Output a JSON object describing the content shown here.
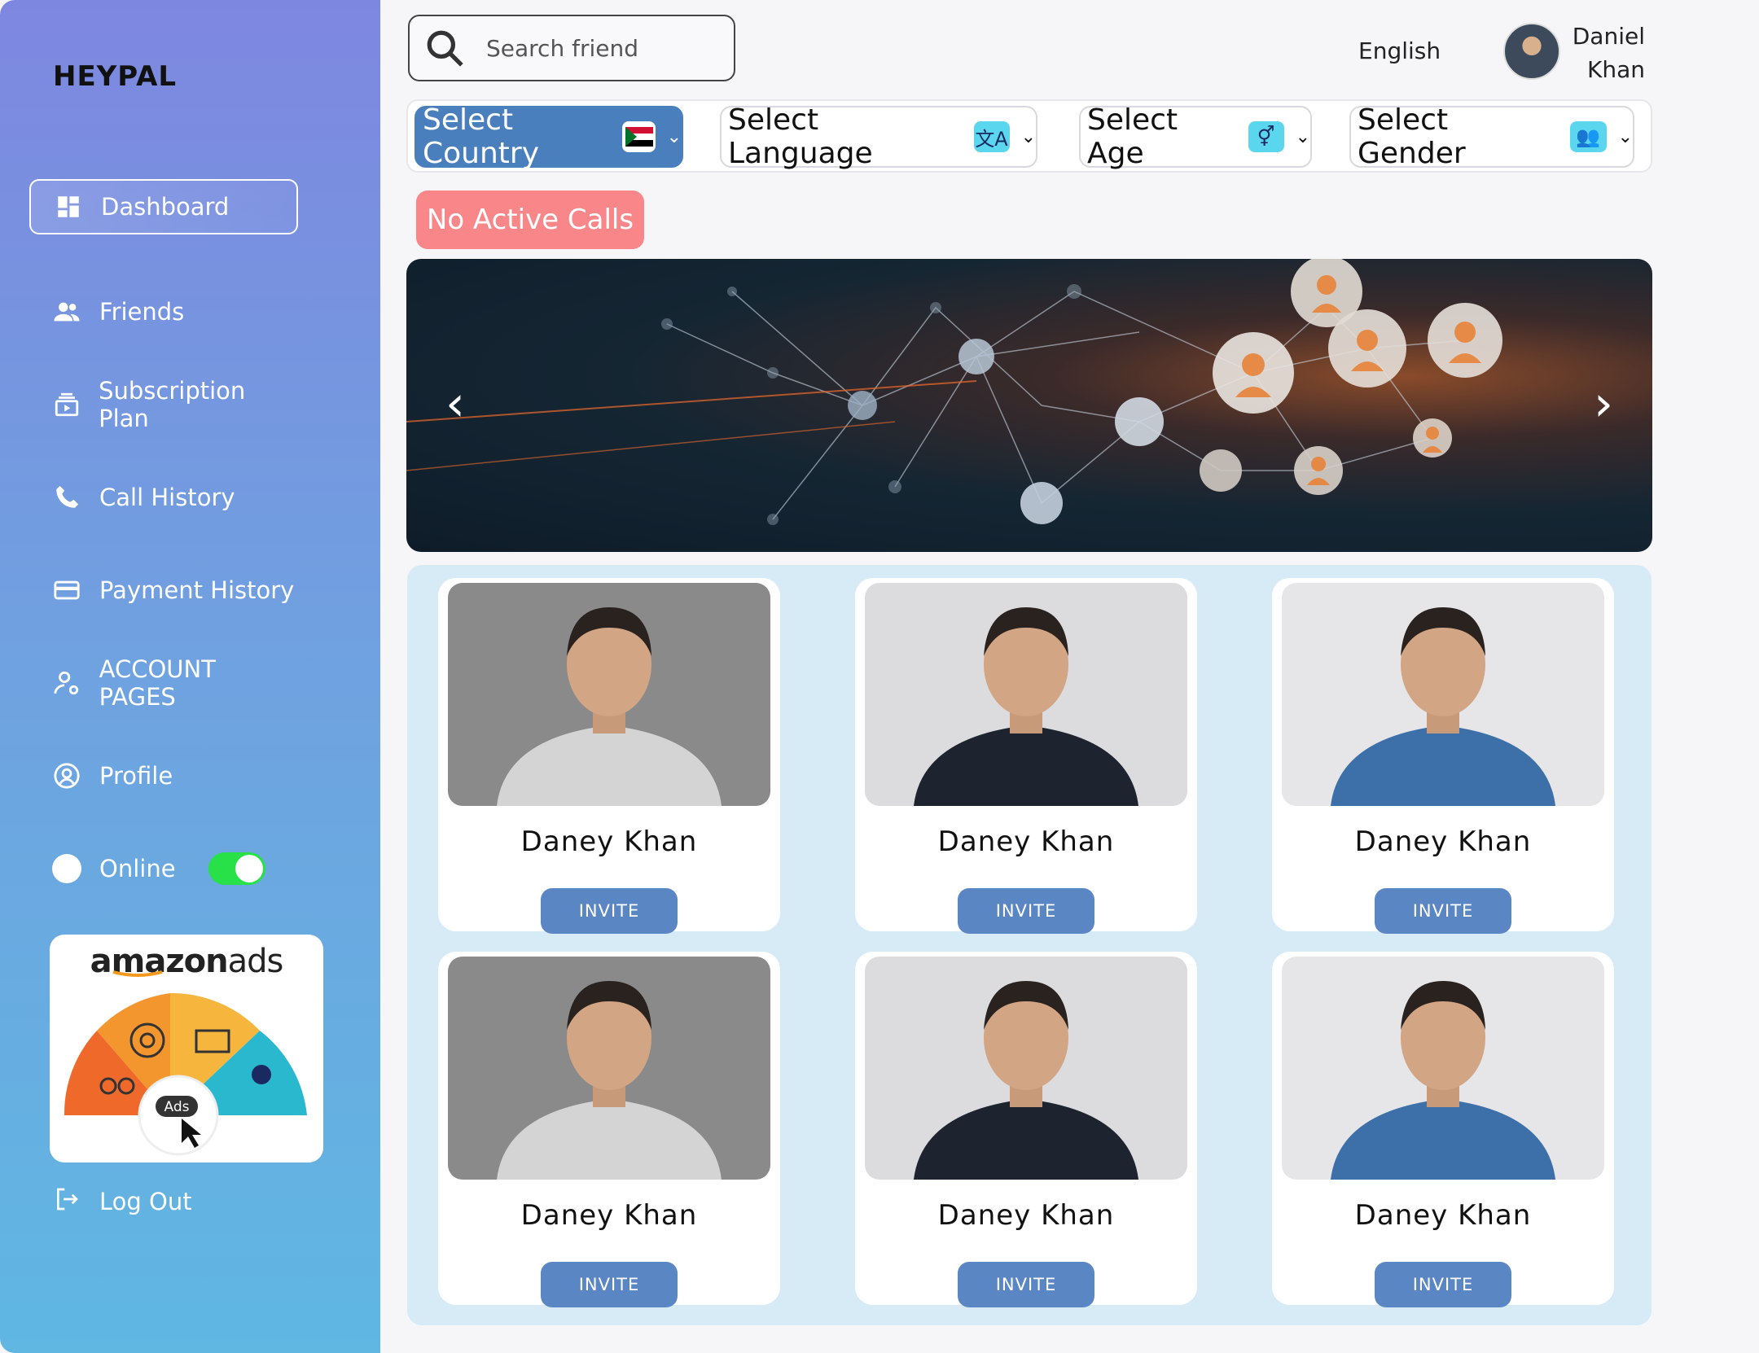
{
  "app": {
    "name": "HEYPAL"
  },
  "sidebar": {
    "items": [
      {
        "label": "Dashboard",
        "icon": "dashboard-icon"
      },
      {
        "label": "Friends",
        "icon": "friends-icon"
      },
      {
        "label": "Subscription Plan",
        "icon": "subscription-icon"
      },
      {
        "label": "Call History",
        "icon": "phone-icon"
      },
      {
        "label": "Payment History",
        "icon": "card-icon"
      },
      {
        "label": "ACCOUNT PAGES",
        "icon": "user-settings-icon"
      },
      {
        "label": "Profile",
        "icon": "profile-icon"
      }
    ],
    "status_label": "Online",
    "status_on": true,
    "logout_label": "Log Out",
    "ad": {
      "brand_light": "amazon",
      "brand_bold": "ads",
      "badge": "Ads"
    }
  },
  "header": {
    "search_placeholder": "Search friend",
    "language": "English",
    "user_first": "Daniel",
    "user_last": "Khan"
  },
  "filters": {
    "country": "Select Country",
    "language": "Select Language",
    "age": "Select Age",
    "gender": "Select Gender"
  },
  "calls": {
    "status": "No Active Calls"
  },
  "friends": [
    {
      "name": "Daney Khan",
      "action": "INVITE"
    },
    {
      "name": "Daney Khan",
      "action": "INVITE"
    },
    {
      "name": "Daney Khan",
      "action": "INVITE"
    },
    {
      "name": "Daney Khan",
      "action": "INVITE"
    },
    {
      "name": "Daney Khan",
      "action": "INVITE"
    },
    {
      "name": "Daney Khan",
      "action": "INVITE"
    }
  ],
  "colors": {
    "accent": "#4a7fbd",
    "calls_pill": "#f9878a",
    "online": "#28e047",
    "grid_bg": "#d7ebf7"
  }
}
